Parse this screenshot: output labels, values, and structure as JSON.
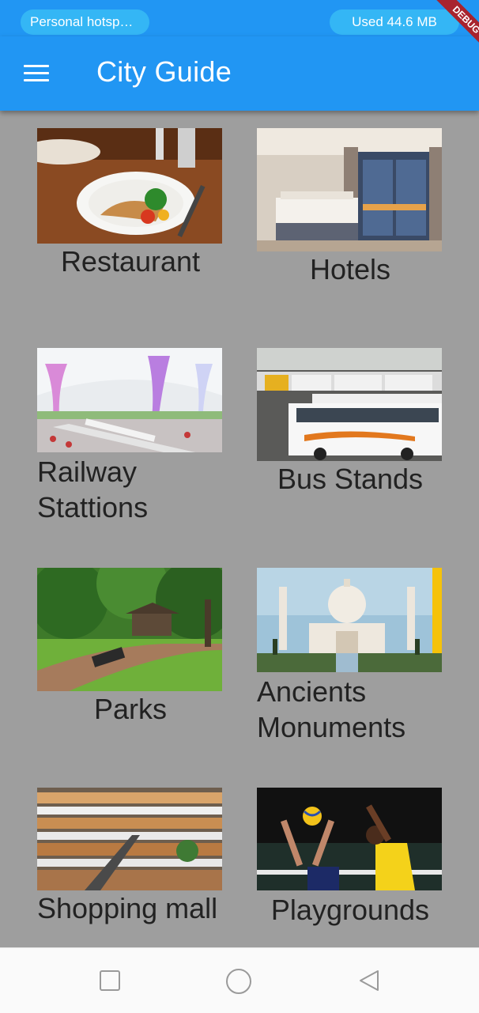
{
  "status_bar": {
    "hotspot_label": "Personal hotspot…",
    "data_used": "Used  44.6 MB"
  },
  "app_bar": {
    "title": "City Guide",
    "menu_icon": "hamburger-menu-icon",
    "debug_banner": "DEBUG"
  },
  "categories": [
    {
      "label": "Restaurant",
      "image": "restaurant-photo"
    },
    {
      "label": "Hotels",
      "image": "hotel-room-photo"
    },
    {
      "label": "Railway Stattions",
      "image": "railway-station-photo"
    },
    {
      "label": "Bus Stands",
      "image": "bus-stand-photo"
    },
    {
      "label": "Parks",
      "image": "park-photo"
    },
    {
      "label": "Ancients Monuments",
      "image": "taj-mahal-photo"
    },
    {
      "label": "Shopping mall",
      "image": "shopping-mall-photo"
    },
    {
      "label": "Playgrounds",
      "image": "volleyball-photo"
    }
  ],
  "nav_bar": {
    "recents_icon": "square-recents-icon",
    "home_icon": "circle-home-icon",
    "back_icon": "triangle-back-icon"
  },
  "colors": {
    "primary": "#2196f3",
    "status_pill": "#34b6f5",
    "background": "#9e9e9e",
    "debug_banner": "#a8232e"
  }
}
